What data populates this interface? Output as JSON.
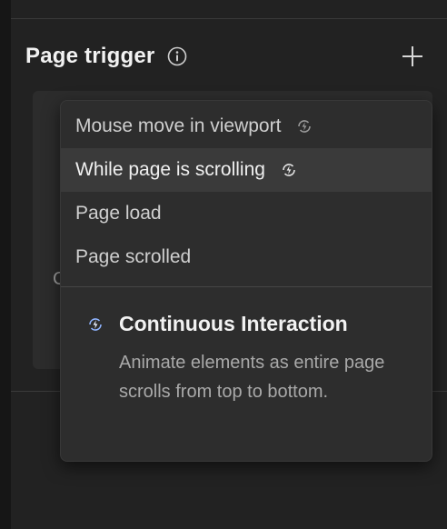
{
  "section": {
    "title": "Page trigger"
  },
  "menu": {
    "items": [
      {
        "label": "Mouse move in viewport",
        "continuous": true
      },
      {
        "label": "While page is scrolling",
        "continuous": true
      },
      {
        "label": "Page load",
        "continuous": false
      },
      {
        "label": "Page scrolled",
        "continuous": false
      }
    ],
    "highlighted_index": 1
  },
  "info": {
    "title": "Continuous Interaction",
    "description": "Animate elements as entire page scrolls from top to bottom."
  },
  "background_fragment": "C",
  "colors": {
    "panel_bg": "#222222",
    "dropdown_bg": "#2d2d2d",
    "highlight_bg": "#3a3a3a",
    "text_primary": "#f2f2f2",
    "text_secondary": "#a9a9a9",
    "bolt_accent": "#8fb4ff"
  },
  "icons": {
    "info": "info-icon",
    "add": "plus-icon",
    "continuous": "bolt-cycle-icon"
  }
}
